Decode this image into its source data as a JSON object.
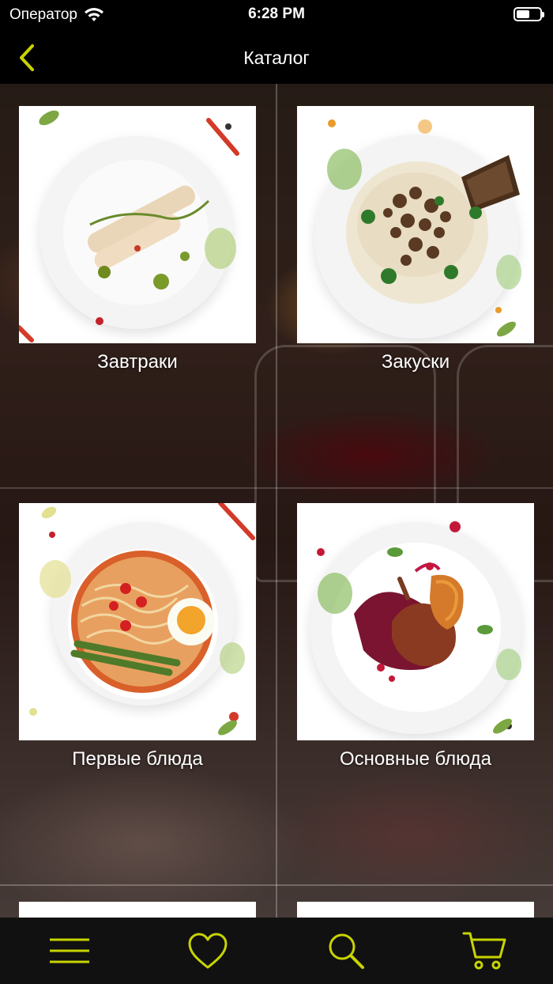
{
  "status_bar": {
    "carrier": "Оператор",
    "time": "6:28 PM"
  },
  "nav": {
    "title": "Каталог"
  },
  "categories": [
    {
      "label": "Завтраки"
    },
    {
      "label": "Закуски"
    },
    {
      "label": "Первые блюда"
    },
    {
      "label": "Основные блюда"
    }
  ],
  "tab_bar": {
    "accent": "#c8d400",
    "icons": [
      "menu-icon",
      "heart-icon",
      "search-icon",
      "cart-icon"
    ]
  }
}
